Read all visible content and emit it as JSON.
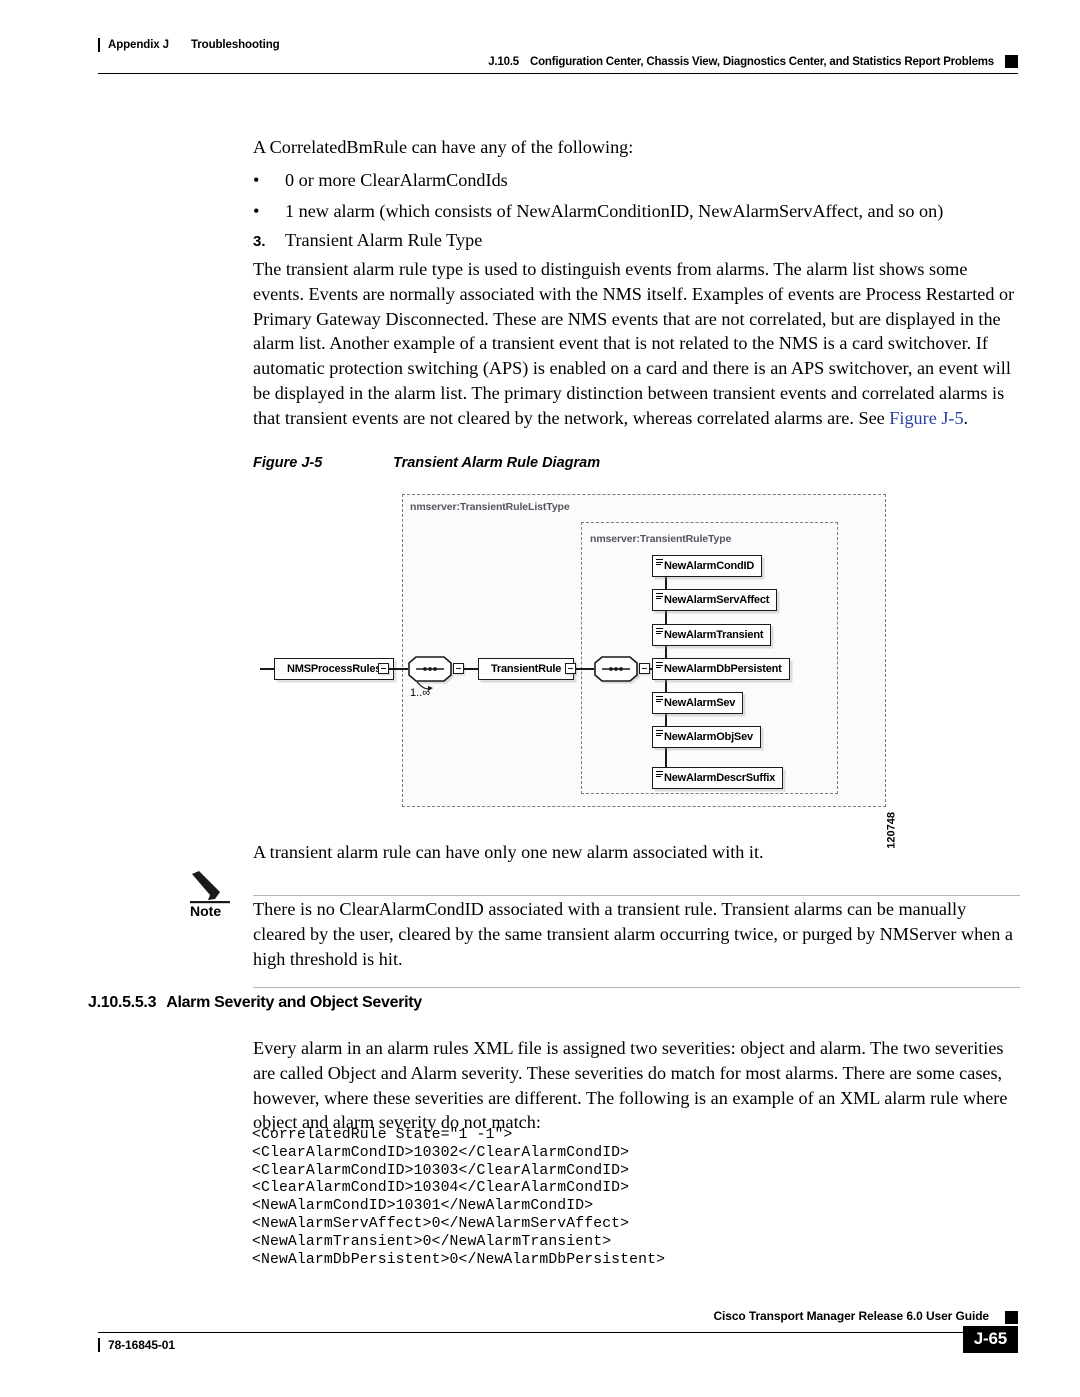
{
  "header": {
    "appendix": "Appendix J",
    "chapter": "Troubleshooting",
    "section_number": "J.10.5",
    "section_title": "Configuration Center, Chassis View, Diagnostics Center, and Statistics Report Problems"
  },
  "body": {
    "intro": "A CorrelatedBmRule can have any of the following:",
    "bullet_mark": "•",
    "bullets": [
      "0 or more ClearAlarmCondIds",
      "1 new alarm (which consists of NewAlarmConditionID, NewAlarmServAffect, and so on)"
    ],
    "step_number": "3.",
    "step_title": "Transient Alarm Rule Type",
    "paragraph_pre_link": "The transient alarm rule type is used to distinguish events from alarms. The alarm list shows some events. Events are normally associated with the NMS itself. Examples of events are Process Restarted or Primary Gateway Disconnected. These are NMS events that are not correlated, but are displayed in the alarm list. Another example of a transient event that is not related to the NMS is a card switchover. If automatic protection switching (APS) is enabled on a card and there is an APS switchover, an event will be displayed in the alarm list. The primary distinction between transient events and correlated alarms is that transient events are not cleared by the network, whereas correlated alarms are. See ",
    "paragraph_link": "Figure J-5",
    "paragraph_post_link": ".",
    "after_figure": "A transient alarm rule can have only one new alarm associated with it."
  },
  "figure": {
    "caption_number": "Figure J-5",
    "caption_title": "Transient Alarm Rule Diagram",
    "figure_id": "120748",
    "outer_type_label": "nmserver:TransientRuleListType",
    "inner_type_label": "nmserver:TransientRuleType",
    "root_node": "NMSProcessRules",
    "middle_node": "TransientRule",
    "occurrence": "1..∞",
    "elements": [
      "NewAlarmCondID",
      "NewAlarmServAffect",
      "NewAlarmTransient",
      "NewAlarmDbPersistent",
      "NewAlarmSev",
      "NewAlarmObjSev",
      "NewAlarmDescrSuffix"
    ]
  },
  "note": {
    "label": "Note",
    "text": "There is no ClearAlarmCondID associated with a transient rule. Transient alarms can be manually cleared by the user, cleared by the same transient alarm occurring twice, or purged by NMServer when a high threshold is hit."
  },
  "section": {
    "number": "J.10.5.5.3",
    "title": "Alarm Severity and Object Severity",
    "paragraph": "Every alarm in an alarm rules XML file is assigned two severities: object and alarm. The two severities are called Object and Alarm severity. These severities do match for most alarms. There are some cases, however, where these severities are different. The following is an example of an XML alarm rule where object and alarm severity do not match:"
  },
  "code": {
    "lines": [
      "<CorrelatedRule State=\"1 -1\">",
      "<ClearAlarmCondID>10302</ClearAlarmCondID>",
      "<ClearAlarmCondID>10303</ClearAlarmCondID>",
      "<ClearAlarmCondID>10304</ClearAlarmCondID>",
      "<NewAlarmCondID>10301</NewAlarmCondID>",
      "<NewAlarmServAffect>0</NewAlarmServAffect>",
      "<NewAlarmTransient>0</NewAlarmTransient>",
      "<NewAlarmDbPersistent>0</NewAlarmDbPersistent>"
    ],
    "text": "<CorrelatedRule State=\"1 -1\">\n<ClearAlarmCondID>10302</ClearAlarmCondID>\n<ClearAlarmCondID>10303</ClearAlarmCondID>\n<ClearAlarmCondID>10304</ClearAlarmCondID>\n<NewAlarmCondID>10301</NewAlarmCondID>\n<NewAlarmServAffect>0</NewAlarmServAffect>\n<NewAlarmTransient>0</NewAlarmTransient>\n<NewAlarmDbPersistent>0</NewAlarmDbPersistent>"
  },
  "footer": {
    "guide_title": "Cisco Transport Manager Release 6.0 User Guide",
    "doc_number": "78-16845-01",
    "page_number": "J-65"
  },
  "colors": {
    "link": "#2b3f9e",
    "dashed_border": "#7a7a8c",
    "type_label": "#55555f",
    "note_rule": "#b5b5b5"
  }
}
